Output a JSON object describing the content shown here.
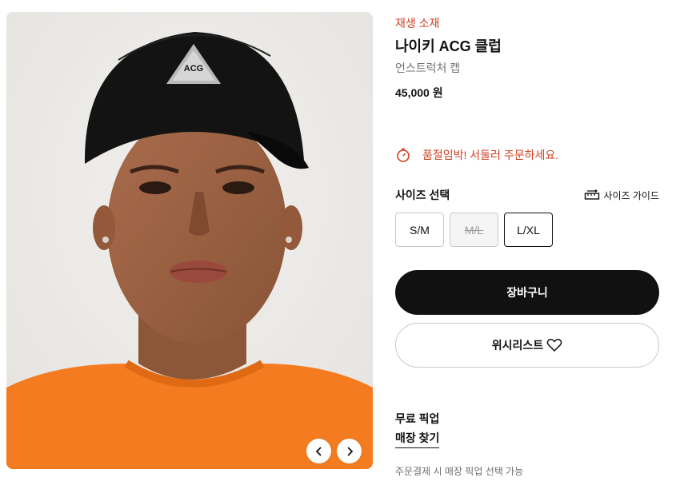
{
  "product": {
    "badge": "재생 소재",
    "title": "나이키 ACG 클럽",
    "subtitle": "언스트럭처 캡",
    "price": "45,000 원",
    "image_alt": "product-photo-person-wearing-black-acg-cap",
    "cap_logo_text": "ACG"
  },
  "urgency": {
    "icon": "stopwatch-icon",
    "text": "품절임박! 서둘러 주문하세요."
  },
  "size": {
    "title": "사이즈 선택",
    "guide_label": "사이즈 가이드",
    "guide_icon": "ruler-icon",
    "options": [
      {
        "label": "S/M",
        "available": true,
        "selected": false
      },
      {
        "label": "M/L",
        "available": false,
        "selected": false
      },
      {
        "label": "L/XL",
        "available": true,
        "selected": true
      }
    ]
  },
  "actions": {
    "cart_label": "장바구니",
    "wishlist_label": "위시리스트",
    "wishlist_icon": "heart-icon"
  },
  "pickup": {
    "title": "무료 픽업",
    "link_label": "매장 찾기",
    "note": "주문결제 시 매장 픽업 선택 가능"
  },
  "carousel": {
    "prev_icon": "chevron-left-icon",
    "next_icon": "chevron-right-icon"
  },
  "colors": {
    "accent_red": "#d43f21",
    "primary_black": "#111111",
    "muted_gray": "#707072",
    "border_gray": "#cacacb",
    "shirt_orange": "#f47b20"
  }
}
